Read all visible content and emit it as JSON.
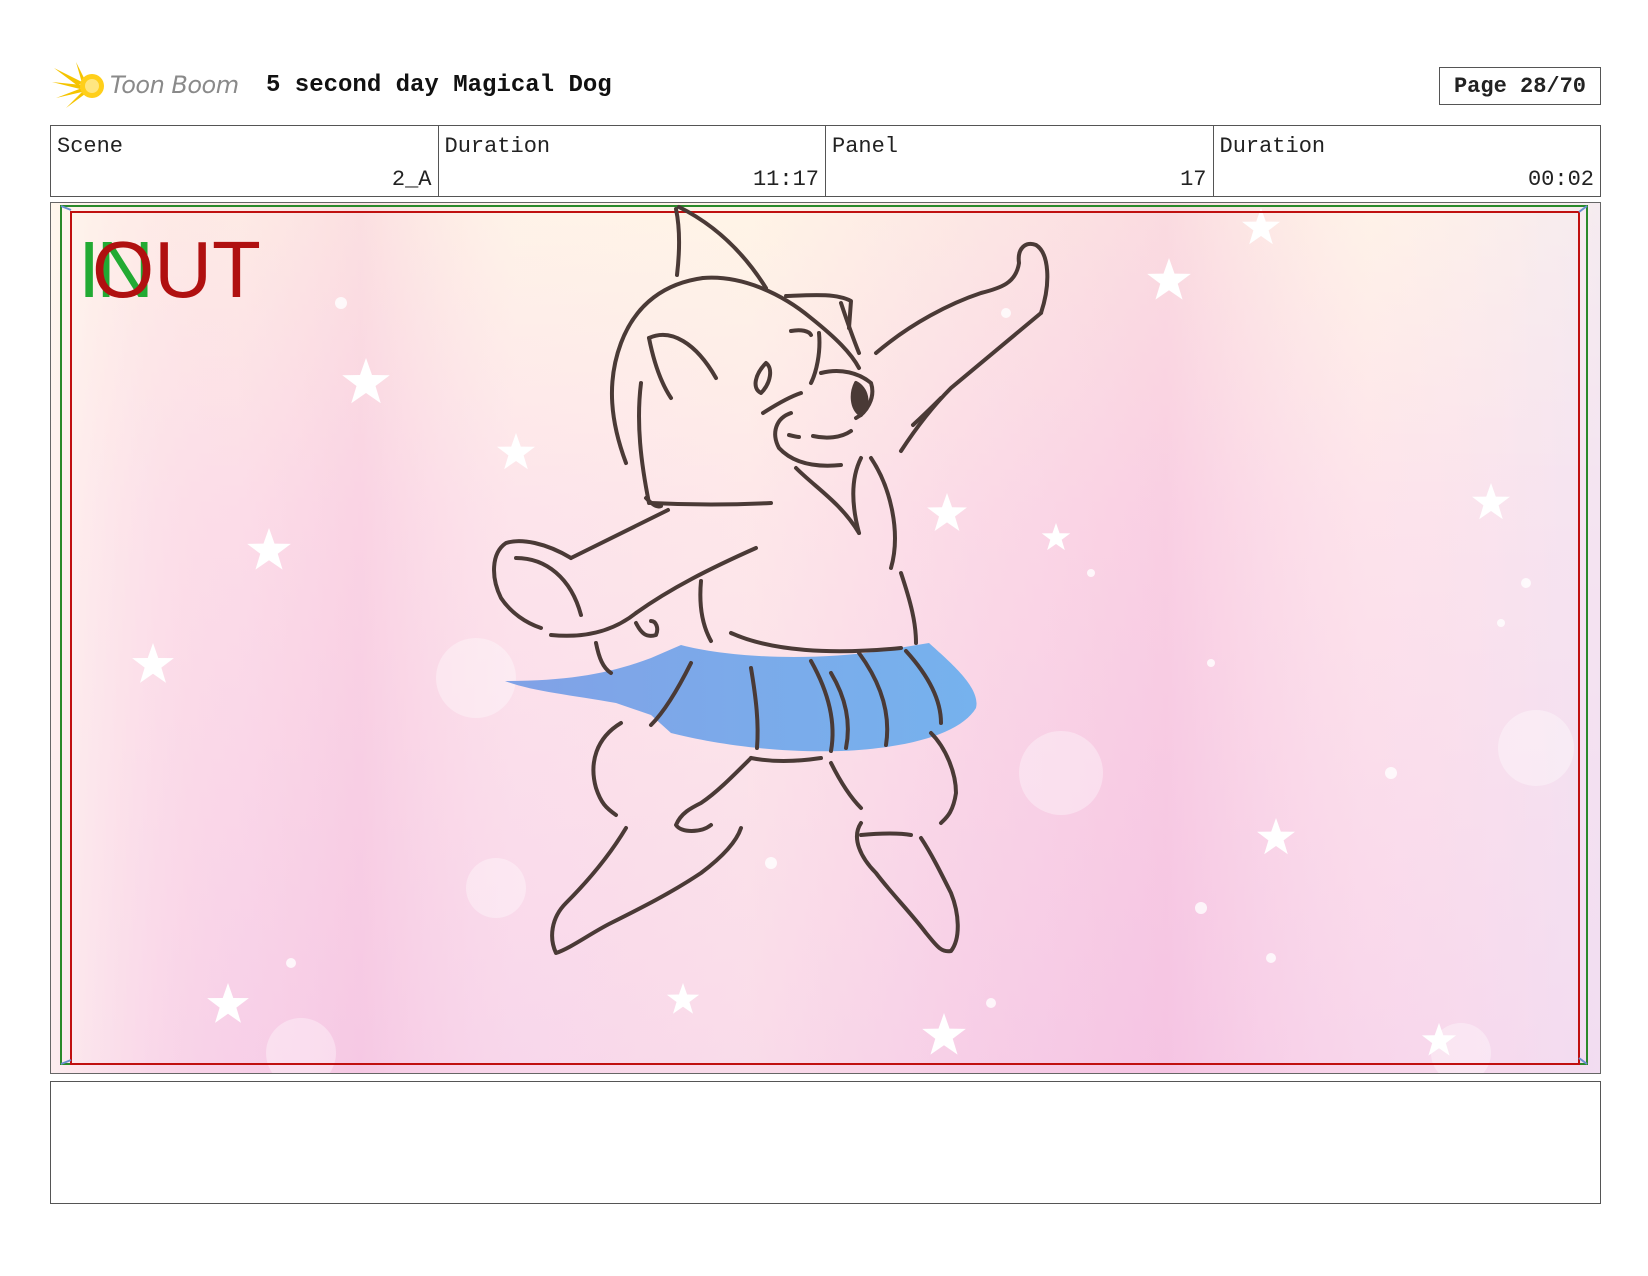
{
  "header": {
    "logo_text": "Toon Boom",
    "project_title": "5 second day Magical Dog",
    "page_label": "Page 28/70"
  },
  "info": {
    "scene_label": "Scene",
    "scene_value": "2_A",
    "duration_label": "Duration",
    "duration_value": "11:17",
    "panel_label": "Panel",
    "panel_value": "17",
    "panel_duration_label": "Duration",
    "panel_duration_value": "00:02"
  },
  "overlay": {
    "in_text": "IN",
    "out_text": "OUT",
    "in_color": "#22aa33",
    "out_color": "#b01010"
  },
  "drawing": {
    "subject_icon": "dog-sketch-icon",
    "skirt_color": "#6fa8e8",
    "line_color": "#4a3a36"
  },
  "notes": {
    "text": ""
  }
}
